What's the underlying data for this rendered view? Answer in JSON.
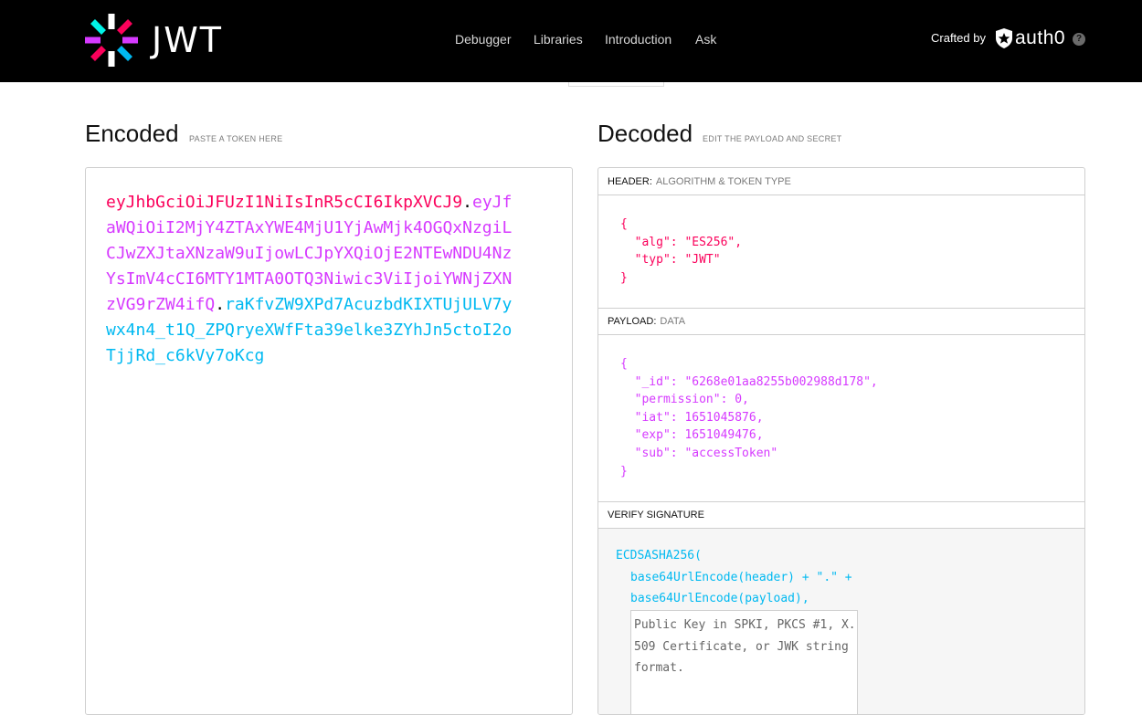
{
  "header": {
    "logo_text": "JWT",
    "nav": [
      "Debugger",
      "Libraries",
      "Introduction",
      "Ask"
    ],
    "crafted_by": "Crafted by",
    "brand": "auth0",
    "help_icon": "help-icon"
  },
  "encoded": {
    "title": "Encoded",
    "subtitle": "PASTE A TOKEN HERE",
    "token_header": "eyJhbGciOiJFUzI1NiIsInR5cCI6IkpXVCJ9",
    "token_payload": "eyJfaWQiOiI2MjY4ZTAxYWE4MjU1YjAwMjk4OGQxNzgiLCJwZXJtaXNzaW9uIjowLCJpYXQiOjE2NTEwNDU4NzYsImV4cCI6MTY1MTA0OTQ3Niwic3ViIjoiYWNjZXNzVG9rZW4ifQ",
    "token_signature": "raKfvZW9XPd7AcuzbdKIXTUjULV7ywx4n4_t1Q_ZPQryeXWfFta39elke3ZYhJn5ctoI2oTjjRd_c6kVy7oKcg",
    "dot": "."
  },
  "decoded": {
    "title": "Decoded",
    "subtitle": "EDIT THE PAYLOAD AND SECRET",
    "header_label": "HEADER:",
    "header_sub": "ALGORITHM & TOKEN TYPE",
    "header_json": "{\n  \"alg\": \"ES256\",\n  \"typ\": \"JWT\"\n}",
    "payload_label": "PAYLOAD:",
    "payload_sub": "DATA",
    "payload_json": "{\n  \"_id\": \"6268e01aa8255b002988d178\",\n  \"permission\": 0,\n  \"iat\": 1651045876,\n  \"exp\": 1651049476,\n  \"sub\": \"accessToken\"\n}",
    "verify_label": "VERIFY SIGNATURE",
    "verify_code_1": "ECDSASHA256(",
    "verify_code_2": "base64UrlEncode(header) + \".\" +",
    "verify_code_3": "base64UrlEncode(payload),",
    "public_key_placeholder": "Public Key in SPKI, PKCS #1, X.509 Certificate, or JWK string format."
  },
  "colors": {
    "header": "#fb015b",
    "payload": "#d63aff",
    "signature": "#00b9f1"
  }
}
